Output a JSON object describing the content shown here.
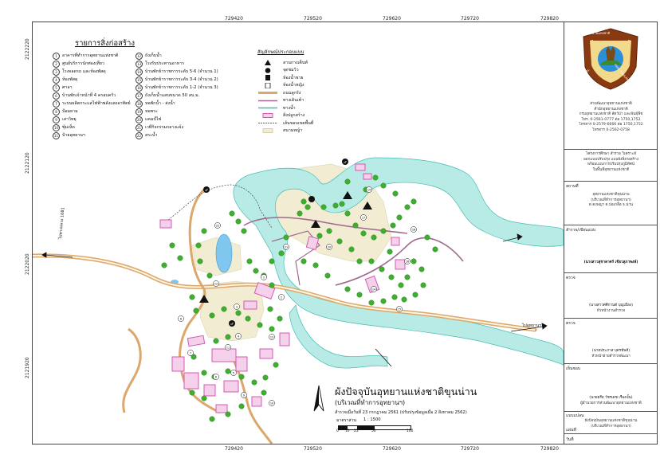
{
  "frame": {
    "top_ticks": [
      "729420",
      "729520",
      "729620",
      "729720",
      "729820"
    ],
    "bottom_ticks": [
      "729420",
      "729520",
      "729620",
      "729720",
      "729820"
    ],
    "left_ticks": [
      "2122120",
      "2122020",
      "2121920"
    ],
    "left_top": "2122220"
  },
  "legend": {
    "title": "รายการสิ่งก่อสร้าง",
    "items_col1": [
      {
        "n": "1",
        "t": "อาคารที่ทำการอุทยานแห่งชาติ"
      },
      {
        "n": "2",
        "t": "ศูนย์บริการนักท่องเที่ยว"
      },
      {
        "n": "3",
        "t": "โรงจอดรถ และห้องพัสดุ"
      },
      {
        "n": "4",
        "t": "ห้องพัสดุ"
      },
      {
        "n": "5",
        "t": "ศาลา"
      },
      {
        "n": "6",
        "t": "บ้านพักเจ้าหน้าที่ 4 ครอบครัว"
      },
      {
        "n": "7",
        "t": "ระบบผลิตกระแสไฟฟ้าพลังแสงอาทิตย์"
      },
      {
        "n": "8",
        "t": "ป้อมยาม"
      },
      {
        "n": "9",
        "t": "เสาวิทยุ"
      },
      {
        "n": "10",
        "t": "ซุ้มเห็ด"
      },
      {
        "n": "11",
        "t": "ป้ายอุทยานฯ"
      }
    ],
    "items_col2": [
      {
        "n": "12",
        "t": "ถังเก็บน้ำ"
      },
      {
        "n": "13",
        "t": "โรงรับประทานอาหาร"
      },
      {
        "n": "14",
        "t": "บ้านพักข้าราชการระดับ 5-6 (จำนวน 1)"
      },
      {
        "n": "15",
        "t": "บ้านพักข้าราชการระดับ 3-4 (จำนวน 2)"
      },
      {
        "n": "16",
        "t": "บ้านพักข้าราชการระดับ 1-2 (จำนวน 3)"
      },
      {
        "n": "17",
        "t": "ถังเก็บน้ำแสนขนาด 50 ลบ.ม."
      },
      {
        "n": "18",
        "t": "หอพักน้ำ - ส่งน้ำ"
      },
      {
        "n": "19",
        "t": "หอพระ"
      },
      {
        "n": "20",
        "t": "แคมป์ไฟ"
      },
      {
        "n": "21",
        "t": "เวทีกิจกรรมกลางแจ้ง"
      },
      {
        "n": "22",
        "t": "สระน้ำ"
      }
    ],
    "symbols_title": "สัญลักษณ์ประกอบแบบ",
    "symbols": [
      {
        "t": "ลานกางเต็นท์",
        "icon": "tent-icon"
      },
      {
        "t": "จุดชมวิว",
        "icon": "viewpoint-icon"
      },
      {
        "t": "ห้องน้ำชาย",
        "icon": "restroom-male-icon"
      },
      {
        "t": "ห้องน้ำหญิง",
        "icon": "restroom-female-icon"
      },
      {
        "t": "ถนนลูกรัง",
        "icon": "gravel-road-line"
      },
      {
        "t": "ทางเดินเท้า",
        "icon": "footpath-line"
      },
      {
        "t": "ทางน้ำ",
        "icon": "waterway-line"
      },
      {
        "t": "สิ่งปลูกสร้าง",
        "icon": "building-box"
      },
      {
        "t": "เส้นขอบเขตพื้นที่",
        "icon": "boundary-line"
      },
      {
        "t": "สนามหญ้า",
        "icon": "lawn-box"
      }
    ]
  },
  "map_labels": {
    "road_left": "ไปทางหลวง 1081",
    "road_right": "ไปอุทยานฯ",
    "circles": [
      "1",
      "2",
      "3",
      "4",
      "5",
      "6",
      "7",
      "8",
      "9",
      "10",
      "11",
      "12",
      "13",
      "14",
      "15",
      "16",
      "17",
      "18",
      "19",
      "20",
      "21",
      "22"
    ]
  },
  "title_block": {
    "main": "ผังปัจจุบันอุทยานแห่งชาติขุนน่าน",
    "sub": "(บริเวณที่ทำการอุทยานฯ)",
    "survey": "สำรวจเมื่อวันที่ 23 กรกฎาคม 2561 (ปรับปรุงข้อมูลเมื่อ 2 สิงหาคม 2562)",
    "scale_label": "มาตราส่วน",
    "scale_value": "1 : 1500",
    "scale_ticks": [
      "0",
      "10",
      "25",
      "50",
      "100"
    ]
  },
  "panel": {
    "logo_top": "อุทยานแห่งชาติ",
    "logo_left": "NATIONAL",
    "logo_right": "PARK THAILAND",
    "org": [
      "ส่วนพัฒนาอุทยานแห่งชาติ",
      "สำนักอุทยานแห่งชาติ",
      "กรมอุทยานแห่งชาติ สัตว์ป่า และพันธุ์พืช",
      "โทร. 0-2561-0777 ต่อ 1750,1752",
      "โทรสาร 0-2579-6666 ต่อ 1750,1752",
      "โทรสาร 0-2562-0758"
    ],
    "project_label": "โครงการ",
    "project": [
      "โครงการศึกษา สำรวจ วิเคราะห์",
      "ออกแบบปรับปรุง แบบผังสิ่งก่อสร้าง",
      "พร้อมแบบการปรับปรุงภูมิทัศน์",
      "ในพื้นที่อุทยานแห่งชาติ"
    ],
    "site_label": "สถานที่",
    "site": [
      "อุทยานแห่งชาติขุนน่าน",
      "(บริเวณที่ทำการอุทยานฯ)",
      "ต.ดงพญา ต.บ่อเกลือ จ.น่าน"
    ],
    "surveyor_label": "สำรวจ/เขียนแบบ",
    "surveyor": "(นางสาวสุชาดาศร์ เขียวสุภาพงษ์)",
    "check_label": "ตรวจ",
    "check1": [
      "(นางสาวศศิกานต์ บุญเมือง)",
      "หัวหน้างานสำรวจ"
    ],
    "check2_label": "ตรวจ",
    "check2": [
      "(นายประภาส บุตรทัพท์)",
      "หัวหน้าฝ่ายสำรวจพัฒนา"
    ],
    "approve_label": "เห็นชอบ",
    "approve": [
      "(นายธรีย วัชรเดช เรืองฃั้น)",
      "ผู้อำนวยการส่วนพัฒนาอุทยานแห่งชาติ"
    ],
    "plan_label": "แบบแปลน",
    "plan": [
      "ผังปัจจุบันอุทยานแห่งชาติขุนน่าน",
      "(บริเวณที่ทำการอุทยานฯ)"
    ],
    "sheet_label": "แผ่นที่",
    "date_label": "วันที่"
  },
  "colors": {
    "water": "#b9ebe6",
    "water_edge": "#46bcb4",
    "road": "#dba76a",
    "building": "#d45ab4",
    "tree": "#3fae2f",
    "lawn": "#f1ecd2",
    "footpath": "#a06a90"
  }
}
